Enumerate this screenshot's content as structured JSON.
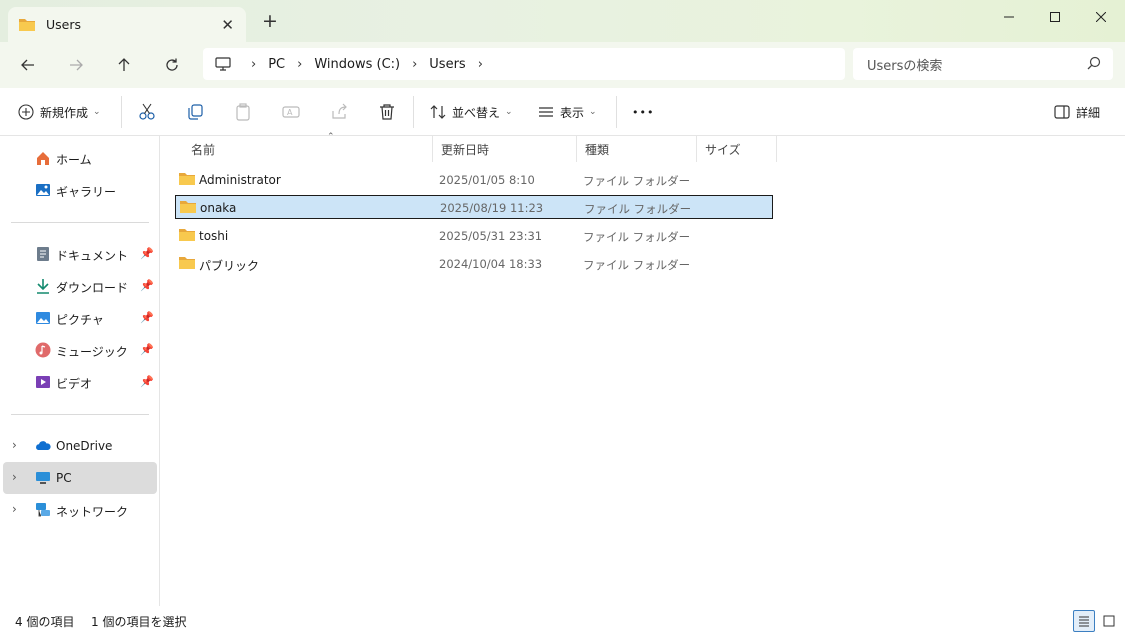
{
  "window": {
    "tab_title": "Users",
    "new_tab": "+",
    "close_tab": "✕",
    "minimize": "—",
    "maximize": "☐",
    "close": "✕"
  },
  "nav": {
    "breadcrumb": [
      "PC",
      "Windows (C:)",
      "Users"
    ],
    "search_placeholder": "Usersの検索"
  },
  "commands": {
    "new": "新規作成",
    "sort": "並べ替え",
    "view": "表示",
    "more": "•••",
    "details": "詳細"
  },
  "sidebar": {
    "quick": [
      {
        "label": "ホーム",
        "icon": "home-icon"
      },
      {
        "label": "ギャラリー",
        "icon": "gallery-icon"
      }
    ],
    "pinned": [
      {
        "label": "ドキュメント",
        "icon": "documents-icon"
      },
      {
        "label": "ダウンロード",
        "icon": "download-icon"
      },
      {
        "label": "ピクチャ",
        "icon": "pictures-icon"
      },
      {
        "label": "ミュージック",
        "icon": "music-icon"
      },
      {
        "label": "ビデオ",
        "icon": "video-icon"
      }
    ],
    "locations": [
      {
        "label": "OneDrive",
        "icon": "onedrive-icon"
      },
      {
        "label": "PC",
        "icon": "pc-icon"
      },
      {
        "label": "ネットワーク",
        "icon": "network-icon"
      }
    ]
  },
  "columns": {
    "name": "名前",
    "date": "更新日時",
    "type": "種類",
    "size": "サイズ"
  },
  "files": [
    {
      "name": "Administrator",
      "date": "2025/01/05 8:10",
      "type": "ファイル フォルダー"
    },
    {
      "name": "onaka",
      "date": "2025/08/19 11:23",
      "type": "ファイル フォルダー"
    },
    {
      "name": "toshi",
      "date": "2025/05/31 23:31",
      "type": "ファイル フォルダー"
    },
    {
      "name": "パブリック",
      "date": "2024/10/04 18:33",
      "type": "ファイル フォルダー"
    }
  ],
  "status": {
    "count": "4 個の項目",
    "selected": "1 個の項目を選択"
  },
  "colors": {
    "accent": "#0067c0",
    "selection": "#cce4f7",
    "folder": "#f8c94e",
    "titlebar": "#e6f0dd"
  }
}
